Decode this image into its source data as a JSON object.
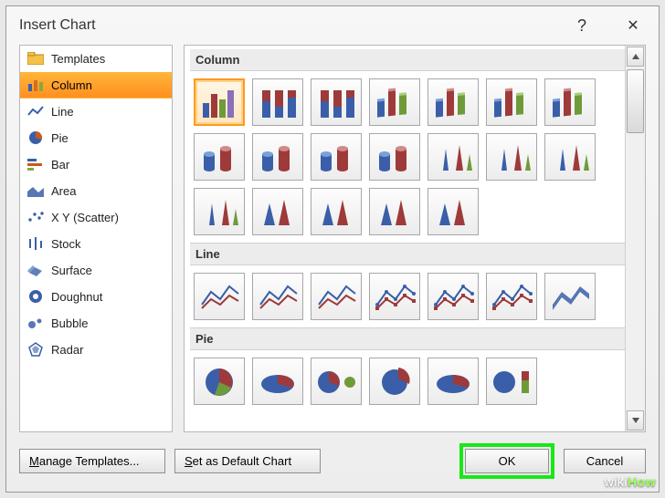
{
  "dialog": {
    "title": "Insert Chart",
    "help_label": "?",
    "close_label": "✕"
  },
  "sidebar": {
    "items": [
      {
        "label": "Templates",
        "icon": "folder-icon",
        "selected": false
      },
      {
        "label": "Column",
        "icon": "column-icon",
        "selected": true
      },
      {
        "label": "Line",
        "icon": "line-icon",
        "selected": false
      },
      {
        "label": "Pie",
        "icon": "pie-icon",
        "selected": false
      },
      {
        "label": "Bar",
        "icon": "bar-icon",
        "selected": false
      },
      {
        "label": "Area",
        "icon": "area-icon",
        "selected": false
      },
      {
        "label": "X Y (Scatter)",
        "icon": "scatter-icon",
        "selected": false
      },
      {
        "label": "Stock",
        "icon": "stock-icon",
        "selected": false
      },
      {
        "label": "Surface",
        "icon": "surface-icon",
        "selected": false
      },
      {
        "label": "Doughnut",
        "icon": "doughnut-icon",
        "selected": false
      },
      {
        "label": "Bubble",
        "icon": "bubble-icon",
        "selected": false
      },
      {
        "label": "Radar",
        "icon": "radar-icon",
        "selected": false
      }
    ]
  },
  "gallery": {
    "groups": [
      {
        "title": "Column",
        "thumbs": [
          {
            "name": "clustered-column",
            "selected": true
          },
          {
            "name": "stacked-column",
            "selected": false
          },
          {
            "name": "100-stacked-column",
            "selected": false
          },
          {
            "name": "3d-clustered-column",
            "selected": false
          },
          {
            "name": "3d-stacked-column",
            "selected": false
          },
          {
            "name": "3d-100-stacked-column",
            "selected": false
          },
          {
            "name": "3d-column",
            "selected": false
          },
          {
            "name": "clustered-cylinder",
            "selected": false
          },
          {
            "name": "stacked-cylinder",
            "selected": false
          },
          {
            "name": "100-stacked-cylinder",
            "selected": false
          },
          {
            "name": "3d-cylinder",
            "selected": false
          },
          {
            "name": "clustered-cone",
            "selected": false
          },
          {
            "name": "stacked-cone",
            "selected": false
          },
          {
            "name": "100-stacked-cone",
            "selected": false
          },
          {
            "name": "3d-cone",
            "selected": false
          },
          {
            "name": "clustered-pyramid",
            "selected": false
          },
          {
            "name": "stacked-pyramid",
            "selected": false
          },
          {
            "name": "100-stacked-pyramid",
            "selected": false
          },
          {
            "name": "3d-pyramid",
            "selected": false
          }
        ]
      },
      {
        "title": "Line",
        "thumbs": [
          {
            "name": "line",
            "selected": false
          },
          {
            "name": "stacked-line",
            "selected": false
          },
          {
            "name": "100-stacked-line",
            "selected": false
          },
          {
            "name": "line-markers",
            "selected": false
          },
          {
            "name": "stacked-line-markers",
            "selected": false
          },
          {
            "name": "100-stacked-line-markers",
            "selected": false
          },
          {
            "name": "3d-line",
            "selected": false
          }
        ]
      },
      {
        "title": "Pie",
        "thumbs": [
          {
            "name": "pie",
            "selected": false
          },
          {
            "name": "3d-pie",
            "selected": false
          },
          {
            "name": "pie-of-pie",
            "selected": false
          },
          {
            "name": "exploded-pie",
            "selected": false
          },
          {
            "name": "exploded-3d-pie",
            "selected": false
          },
          {
            "name": "bar-of-pie",
            "selected": false
          }
        ]
      }
    ]
  },
  "footer": {
    "manage_templates_label": "Manage Templates...",
    "set_default_label": "Set as Default Chart",
    "ok_label": "OK",
    "cancel_label": "Cancel"
  },
  "watermark": {
    "prefix": "wiki",
    "suffix": "How"
  },
  "colors": {
    "orange_sel": "#ff9a1f",
    "highlight_green": "#18e818",
    "blue_chart": "#3a5fa8"
  }
}
